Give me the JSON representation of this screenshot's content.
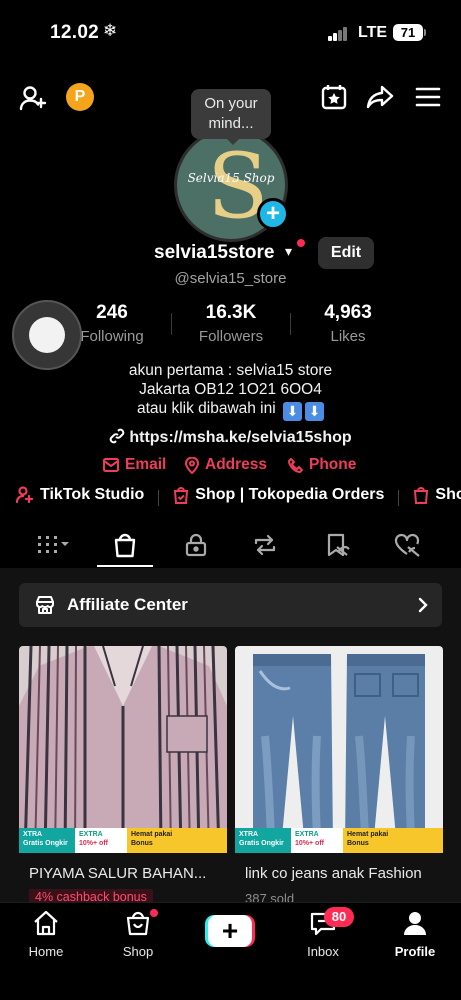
{
  "status_bar": {
    "time": "12.02",
    "weather_icon": "snowflake-icon",
    "network": "LTE",
    "battery": "71"
  },
  "bubble": {
    "text_line1": "On your",
    "text_line2": "mind..."
  },
  "avatar": {
    "logo_letter": "S",
    "logo_text": "Selvia15 Shop"
  },
  "profile": {
    "username": "selvia15store",
    "handle": "@selvia15_store",
    "edit_label": "Edit"
  },
  "stats": [
    {
      "value": "246",
      "label": "Following"
    },
    {
      "value": "16.3K",
      "label": "Followers"
    },
    {
      "value": "4,963",
      "label": "Likes"
    }
  ],
  "bio": {
    "line1": "akun pertama : selvia15 store",
    "line2": "Jakarta OB12 1O21 6OO4",
    "line3": "atau klik dibawah ini",
    "emoji": "⬇️⬇️",
    "link": "https://msha.ke/selvia15shop"
  },
  "contacts": {
    "email": "Email",
    "address": "Address",
    "phone": "Phone"
  },
  "shortcuts": {
    "studio": "TikTok Studio",
    "shop_orders": "Shop | Tokopedia Orders",
    "shop_more": "Sho"
  },
  "affiliate": {
    "label": "Affiliate Center"
  },
  "products": [
    {
      "title": "PIYAMA SALUR BAHAN...",
      "extra": "4% cashback bonus",
      "badge1_line1": "XTRA",
      "badge1_line2": "Gratis Ongkir",
      "badge2_line1": "EXTRA",
      "badge2_line2": "10%+ off",
      "badge3_line1": "Hemat pakai",
      "badge3_line2": "Bonus"
    },
    {
      "title": "link co jeans anak Fashion",
      "extra": "387 sold",
      "badge1_line1": "XTRA",
      "badge1_line2": "Gratis Ongkir",
      "badge2_line1": "EXTRA",
      "badge2_line2": "10%+ off",
      "badge3_line1": "Hemat pakai",
      "badge3_line2": "Bonus"
    }
  ],
  "bottom_nav": {
    "home": "Home",
    "shop": "Shop",
    "create": "+",
    "inbox": "Inbox",
    "inbox_badge": "80",
    "profile": "Profile"
  },
  "colors": {
    "accent_red": "#fe2c55",
    "contact_red": "#ee3d5b",
    "plus_blue": "#1fb8e6",
    "coin_orange": "#f4a51c"
  }
}
